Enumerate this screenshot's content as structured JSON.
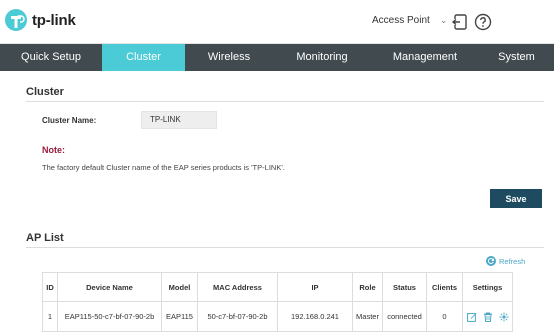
{
  "header": {
    "brand": "tp-link",
    "mode": "Access Point",
    "logout_icon": "logout-icon",
    "help_icon": "help-icon"
  },
  "nav": {
    "tabs": [
      {
        "label": "Quick Setup"
      },
      {
        "label": "Cluster",
        "active": true
      },
      {
        "label": "Wireless"
      },
      {
        "label": "Monitoring"
      },
      {
        "label": "Management"
      },
      {
        "label": "System"
      }
    ]
  },
  "cluster": {
    "title": "Cluster",
    "name_label": "Cluster Name:",
    "name_value": "TP-LINK",
    "note_title": "Note:",
    "note_text": "The factory default Cluster name of the EAP series products is 'TP-LINK'.",
    "save_label": "Save"
  },
  "aplist": {
    "title": "AP List",
    "refresh_label": "Refresh",
    "headers": [
      "ID",
      "Device Name",
      "Model",
      "MAC Address",
      "IP",
      "Role",
      "Status",
      "Clients",
      "Settings"
    ],
    "rows": [
      {
        "id": "1",
        "device_name": "EAP115-50-c7-bf-07-90-2b",
        "model": "EAP115",
        "mac": "50-c7-bf-07-90-2b",
        "ip": "192.168.0.241",
        "role": "Master",
        "status": "connected",
        "clients": "0"
      }
    ]
  },
  "colors": {
    "accent": "#4acbd6",
    "nav_bg": "#414a4f",
    "button": "#1e4b5f",
    "note": "#9b1c3c",
    "icon": "#4aa8c8"
  }
}
